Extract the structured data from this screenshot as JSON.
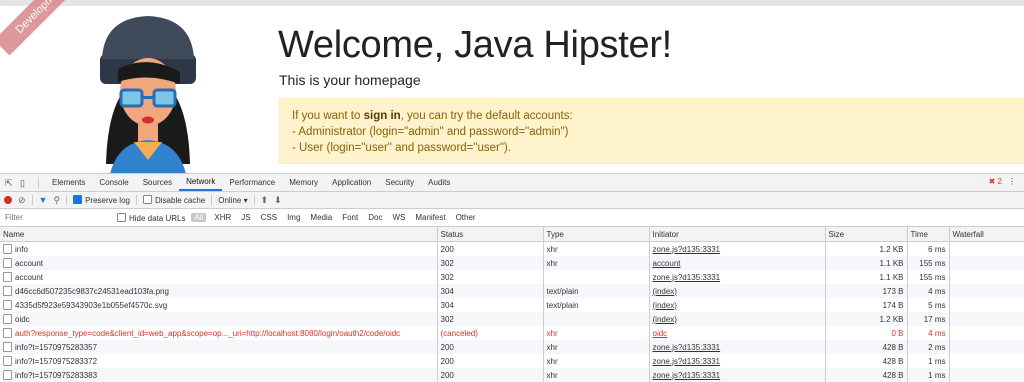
{
  "page": {
    "ribbon": "Development",
    "title": "Welcome, Java Hipster!",
    "subtitle": "This is your homepage",
    "alert": {
      "line1_pre": "If you want to ",
      "line1_bold": "sign in",
      "line1_post": ", you can try the default accounts:",
      "line2": "- Administrator (login=\"admin\" and password=\"admin\")",
      "line3": "- User (login=\"user\" and password=\"user\")."
    }
  },
  "devtools": {
    "tabs": [
      "Elements",
      "Console",
      "Sources",
      "Network",
      "Performance",
      "Memory",
      "Application",
      "Security",
      "Audits"
    ],
    "active_tab": "Network",
    "error_count": "2",
    "toolbar": {
      "preserve_log": "Preserve log",
      "disable_cache": "Disable cache",
      "throttle": "Online"
    },
    "filter": {
      "placeholder": "Filter",
      "hide_data_urls": "Hide data URLs",
      "types": [
        "All",
        "XHR",
        "JS",
        "CSS",
        "Img",
        "Media",
        "Font",
        "Doc",
        "WS",
        "Manifest",
        "Other"
      ]
    },
    "columns": [
      "Name",
      "Status",
      "Type",
      "Initiator",
      "Size",
      "Time",
      "Waterfall"
    ],
    "rows": [
      {
        "name": "info",
        "status": "200",
        "type": "xhr",
        "initiator": "zone.js?d135:3331",
        "size": "1.2 KB",
        "time": "6 ms"
      },
      {
        "name": "account",
        "status": "302",
        "type": "xhr",
        "initiator": "account",
        "size": "1.1 KB",
        "time": "155 ms"
      },
      {
        "name": "account",
        "status": "302",
        "type": "",
        "initiator": "zone.js?d135:3331",
        "size": "1.1 KB",
        "time": "155 ms"
      },
      {
        "name": "d46cc6d507235c9837c24531ead103fa.png",
        "status": "304",
        "type": "text/plain",
        "initiator": "(index)",
        "size": "173 B",
        "time": "4 ms"
      },
      {
        "name": "4335d5f923e59343903e1b055ef4570c.svg",
        "status": "304",
        "type": "text/plain",
        "initiator": "(index)",
        "size": "174 B",
        "time": "5 ms"
      },
      {
        "name": "oidc",
        "status": "302",
        "type": "",
        "initiator": "(index)",
        "size": "1.2 KB",
        "time": "17 ms"
      },
      {
        "name": "auth?response_type=code&client_id=web_app&scope=op..._uri=http://localhost:8080/login/oauth2/code/oidc",
        "status": "(canceled)",
        "type": "xhr",
        "initiator": "oidc",
        "size": "0 B",
        "time": "4 ms",
        "error": true
      },
      {
        "name": "info?t=1570975283357",
        "status": "200",
        "type": "xhr",
        "initiator": "zone.js?d135:3331",
        "size": "428 B",
        "time": "2 ms"
      },
      {
        "name": "info?t=1570975283372",
        "status": "200",
        "type": "xhr",
        "initiator": "zone.js?d135:3331",
        "size": "428 B",
        "time": "1 ms"
      },
      {
        "name": "info?t=1570975283383",
        "status": "200",
        "type": "xhr",
        "initiator": "zone.js?d135:3331",
        "size": "428 B",
        "time": "1 ms"
      }
    ]
  }
}
